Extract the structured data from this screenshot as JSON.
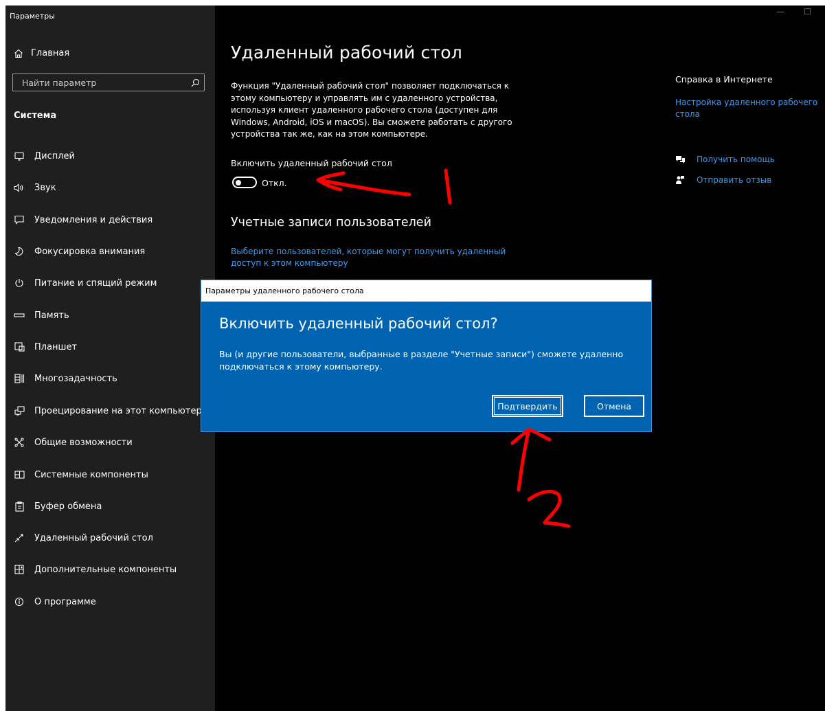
{
  "app": {
    "title": "Параметры"
  },
  "sidebar": {
    "home_label": "Главная",
    "search_placeholder": "Найти параметр",
    "section_title": "Система",
    "items": [
      {
        "label": "Дисплей",
        "icon": "monitor-icon"
      },
      {
        "label": "Звук",
        "icon": "speaker-icon"
      },
      {
        "label": "Уведомления и действия",
        "icon": "notification-icon"
      },
      {
        "label": "Фокусировка внимания",
        "icon": "moon-icon"
      },
      {
        "label": "Питание и спящий режим",
        "icon": "power-icon"
      },
      {
        "label": "Память",
        "icon": "storage-icon"
      },
      {
        "label": "Планшет",
        "icon": "tablet-icon"
      },
      {
        "label": "Многозадачность",
        "icon": "multitasking-icon"
      },
      {
        "label": "Проецирование на этот компьютер",
        "icon": "projecting-icon"
      },
      {
        "label": "Общие возможности",
        "icon": "shared-experiences-icon"
      },
      {
        "label": "Системные компоненты",
        "icon": "system-components-icon"
      },
      {
        "label": "Буфер обмена",
        "icon": "clipboard-icon"
      },
      {
        "label": "Удаленный рабочий стол",
        "icon": "remote-desktop-icon"
      },
      {
        "label": "Дополнительные компоненты",
        "icon": "optional-features-icon"
      },
      {
        "label": "О программе",
        "icon": "info-icon"
      }
    ]
  },
  "main": {
    "title": "Удаленный рабочий стол",
    "description": "Функция \"Удаленный рабочий стол\" позволяет подключаться к этому компьютеру и управлять им с удаленного устройства, используя клиент удаленного рабочего стола (доступен для Windows, Android, iOS и macOS). Вы сможете работать с другого устройства так же, как на этом компьютере.",
    "toggle_label": "Включить удаленный рабочий стол",
    "toggle_state": "Откл.",
    "toggle_on": false,
    "accounts_title": "Учетные записи пользователей",
    "accounts_link": "Выберите пользователей, которые могут получить удаленный доступ к этом компьютеру"
  },
  "help": {
    "title": "Справка в Интернете",
    "link": "Настройка удаленного рабочего стола",
    "get_help": "Получить помощь",
    "feedback": "Отправить отзыв"
  },
  "dialog": {
    "window_title": "Параметры удаленного рабочего стола",
    "heading": "Включить удаленный рабочий стол?",
    "text": "Вы (и другие пользователи, выбранные в разделе \"Учетные записи\") сможете удаленно подключаться к этому компьютеру.",
    "confirm": "Подтвердить",
    "cancel": "Отмена"
  },
  "annotations": {
    "label_1": "1",
    "label_2": "2",
    "color": "#ff0000"
  },
  "colors": {
    "accent": "#0063b1",
    "link": "#3b9cf0",
    "sidebar": "#1f1f1f",
    "content": "#000000"
  }
}
